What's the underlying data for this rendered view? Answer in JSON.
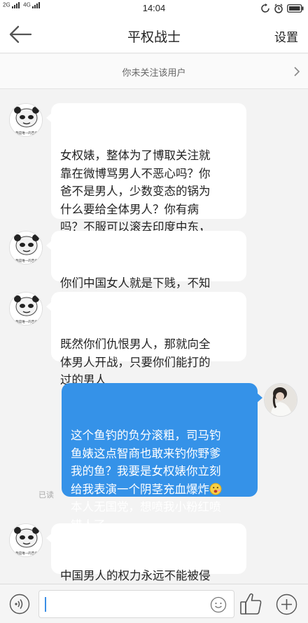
{
  "status": {
    "network_left": "2G",
    "network_right": "4G",
    "time": "14:04",
    "icons": [
      "signal-icon",
      "alarm-icon",
      "clock-icon",
      "battery-icon"
    ]
  },
  "nav": {
    "title": "平权战士",
    "settings_label": "设置",
    "back_icon": "back-arrow-icon"
  },
  "follow_hint": {
    "text": "你未关注该用户",
    "icon": "chevron-right-icon"
  },
  "avatar_caption": "我是唯一的苦命",
  "messages": [
    {
      "side": "in",
      "text": "女权婊，整体为了博取关注就\n靠在微博骂男人不恶心吗？你\n爸不是男人，少数变态的锅为\n什么要给全体男人？你有病\n吗？不服可以滚去印度中东，\n那里对女性友好",
      "emoji": "smile-emoji"
    },
    {
      "side": "in",
      "text": "你们中国女人就是下贱，不知\n足的婊子，都去死吧"
    },
    {
      "side": "in",
      "text": "既然你们仇恨男人，那就向全\n体男人开战，只要你们能打的\n过的男人"
    },
    {
      "side": "out",
      "text": "这个鱼钓的负分滚粗，司马钓\n鱼婊这点智商也敢来钓你野爹\n我的鱼？我要是女权婊你立刻\n给我表演一个阴茎充血爆炸",
      "text2": "本人无国党，想喷我小粉红喷\n错人了。",
      "emoji": "surprised-emoji"
    },
    {
      "side": "in",
      "text": "中国男人的权力永远不能被侵\n犯，懂吗？"
    }
  ],
  "read_label": "已读",
  "input_bar": {
    "placeholder": "",
    "icons": [
      "voice-icon",
      "emoji-icon",
      "thumbs-up-icon",
      "plus-icon"
    ]
  },
  "colors": {
    "outgoing_bubble": "#3592e8",
    "incoming_bubble": "#ffffff",
    "background": "#f3f3f3"
  }
}
